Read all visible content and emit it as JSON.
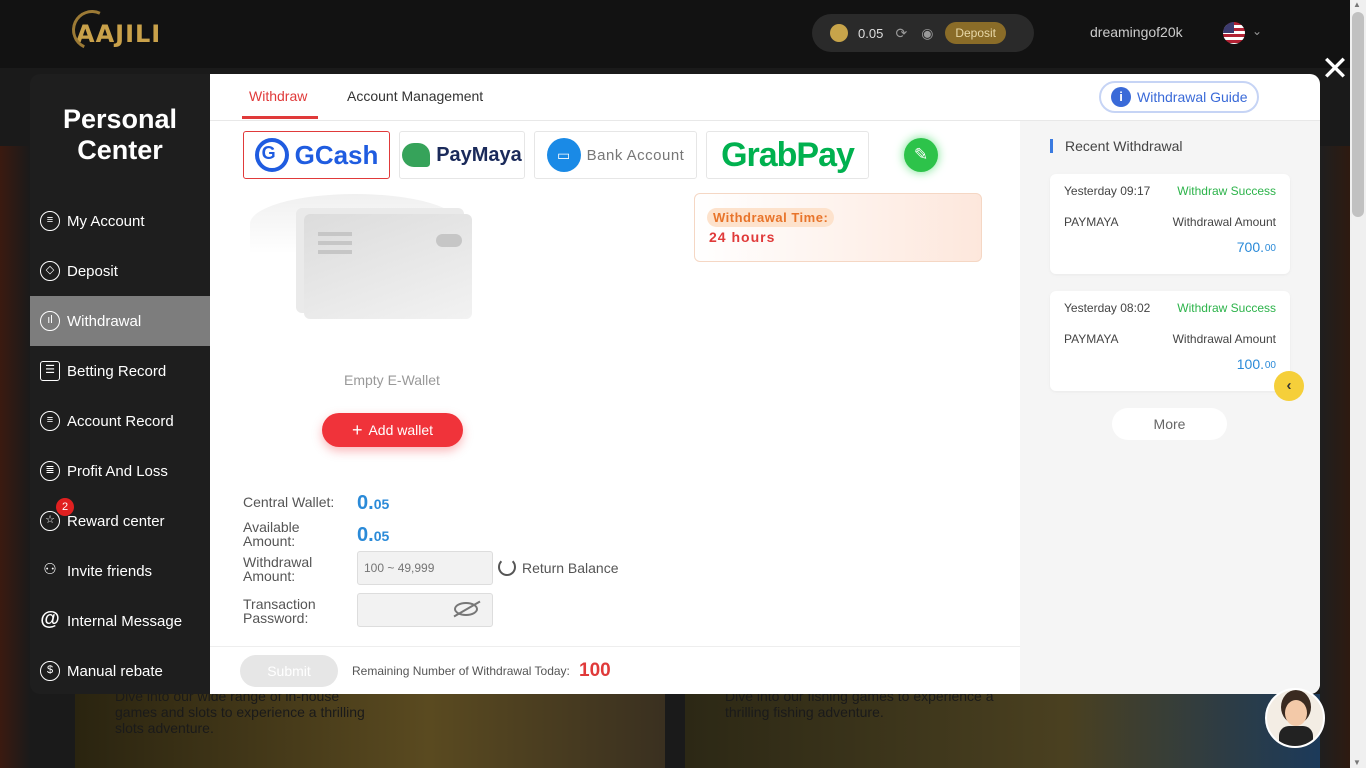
{
  "header": {
    "logo": "AAJILI",
    "balance": "0.05",
    "deposit_label": "Deposit",
    "username": "dreamingof20k"
  },
  "background": {
    "banner_left_text": "Dive into our wide range of in-house games and slots to experience a thrilling slots adventure.",
    "banner_right_text": "Dive into our fishing games to experience a thrilling fishing adventure."
  },
  "sidebar": {
    "title_line1": "Personal",
    "title_line2": "Center",
    "items": [
      {
        "label": "My Account",
        "icon": "user-icon"
      },
      {
        "label": "Deposit",
        "icon": "deposit-icon"
      },
      {
        "label": "Withdrawal",
        "icon": "withdrawal-icon",
        "active": true
      },
      {
        "label": "Betting Record",
        "icon": "clipboard-icon"
      },
      {
        "label": "Account Record",
        "icon": "list-icon"
      },
      {
        "label": "Profit And Loss",
        "icon": "chart-icon"
      },
      {
        "label": "Reward center",
        "icon": "star-icon",
        "badge": "2"
      },
      {
        "label": "Invite friends",
        "icon": "invite-icon"
      },
      {
        "label": "Internal Message",
        "icon": "at-icon"
      },
      {
        "label": "Manual rebate",
        "icon": "rebate-icon"
      }
    ]
  },
  "tabs": {
    "withdraw": "Withdraw",
    "account_management": "Account Management",
    "guide": "Withdrawal Guide"
  },
  "payment_methods": {
    "gcash": "GCash",
    "paymaya": "PayMaya",
    "bank": "Bank Account",
    "grabpay": "GrabPay"
  },
  "wallet": {
    "empty_text": "Empty E-Wallet",
    "add_label": "Add wallet"
  },
  "withdrawal_time": {
    "label": "Withdrawal Time:",
    "value": "24 hours"
  },
  "form": {
    "central_wallet_label": "Central Wallet:",
    "central_wallet_int": "0.",
    "central_wallet_dec": "05",
    "available_label_1": "Available",
    "available_label_2": "Amount:",
    "available_int": "0.",
    "available_dec": "05",
    "amount_label_1": "Withdrawal",
    "amount_label_2": "Amount:",
    "amount_placeholder": "100 ~ 49,999",
    "return_balance": "Return Balance",
    "password_label_1": "Transaction",
    "password_label_2": "Password:"
  },
  "footer": {
    "submit": "Submit",
    "remaining_label": "Remaining Number of Withdrawal Today:",
    "remaining_value": "100"
  },
  "recent": {
    "title": "Recent Withdrawal",
    "records": [
      {
        "time": "Yesterday 09:17",
        "status": "Withdraw Success",
        "method": "PAYMAYA",
        "amount_label": "Withdrawal Amount",
        "amount": "700.",
        "cents": "00"
      },
      {
        "time": "Yesterday 08:02",
        "status": "Withdraw Success",
        "method": "PAYMAYA",
        "amount_label": "Withdrawal Amount",
        "amount": "100.",
        "cents": "00"
      }
    ],
    "more": "More"
  },
  "colors": {
    "accent_red": "#e03a3a",
    "success_green": "#2cb34a",
    "value_blue": "#2a8ad8"
  }
}
